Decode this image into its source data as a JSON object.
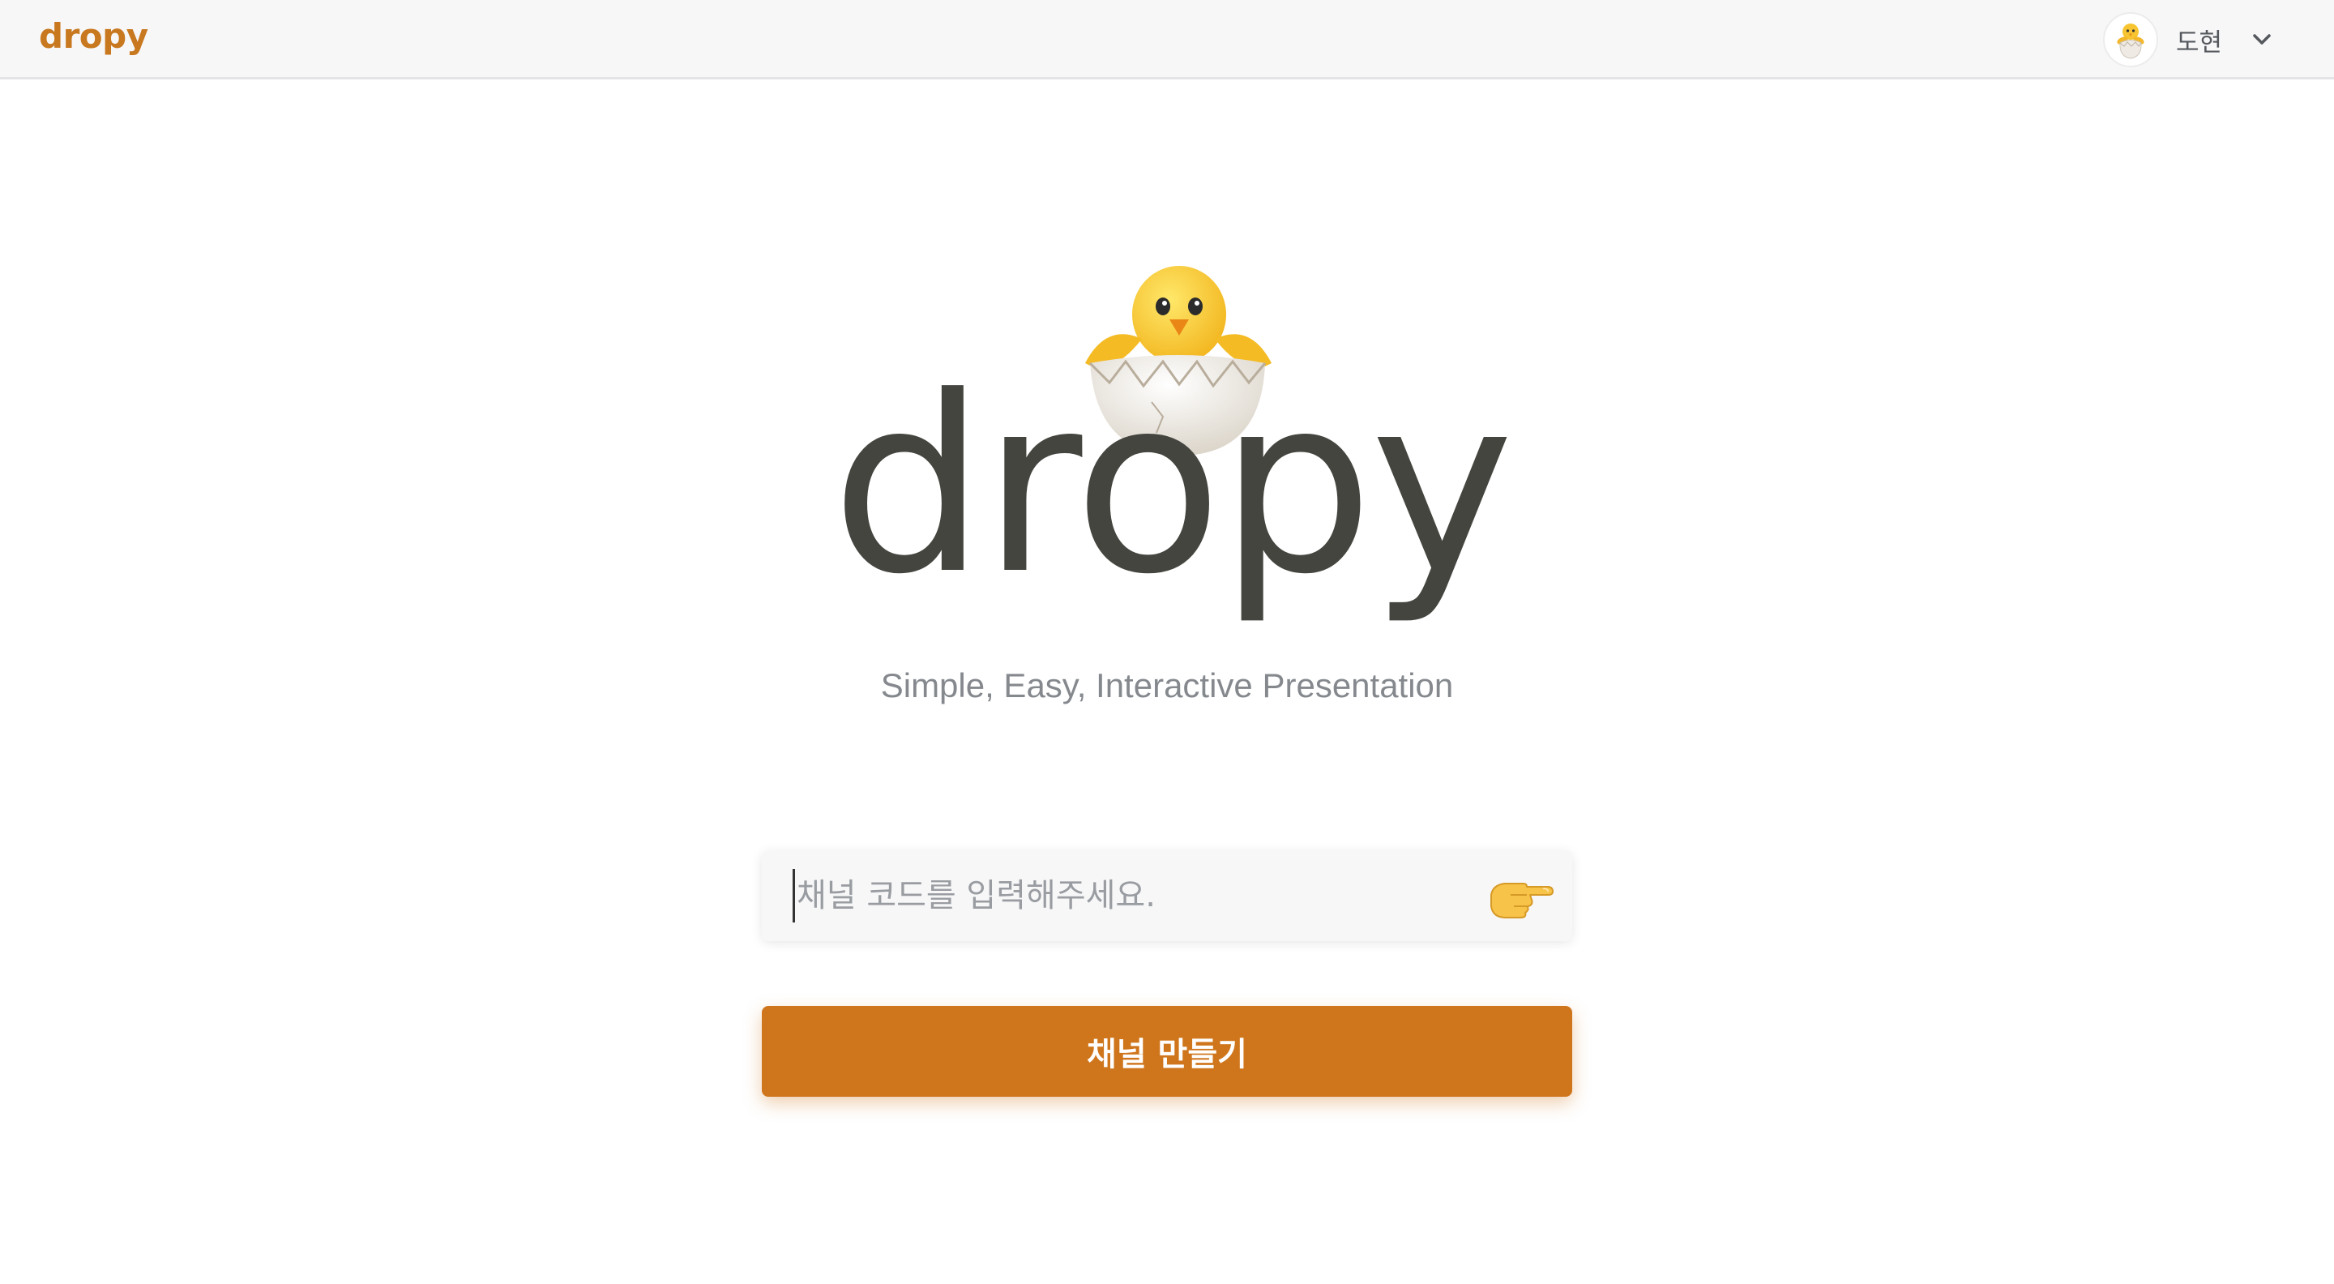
{
  "header": {
    "brand": "dropy",
    "user": {
      "name": "도현",
      "avatar_icon": "hatching-chick-icon",
      "menu_icon": "chevron-down-icon"
    }
  },
  "hero": {
    "logo_icon": "hatching-chick-icon",
    "logo_text": "dropy",
    "tagline": "Simple, Easy, Interactive Presentation"
  },
  "channel": {
    "code_value": "",
    "code_placeholder": "채널 코드를 입력해주세요.",
    "submit_icon": "pointing-right-hand-icon",
    "create_label": "채널 만들기"
  },
  "colors": {
    "brand": "#c8781e",
    "button": "#cf761d",
    "logo_text": "#454540",
    "tagline": "#85898e"
  }
}
